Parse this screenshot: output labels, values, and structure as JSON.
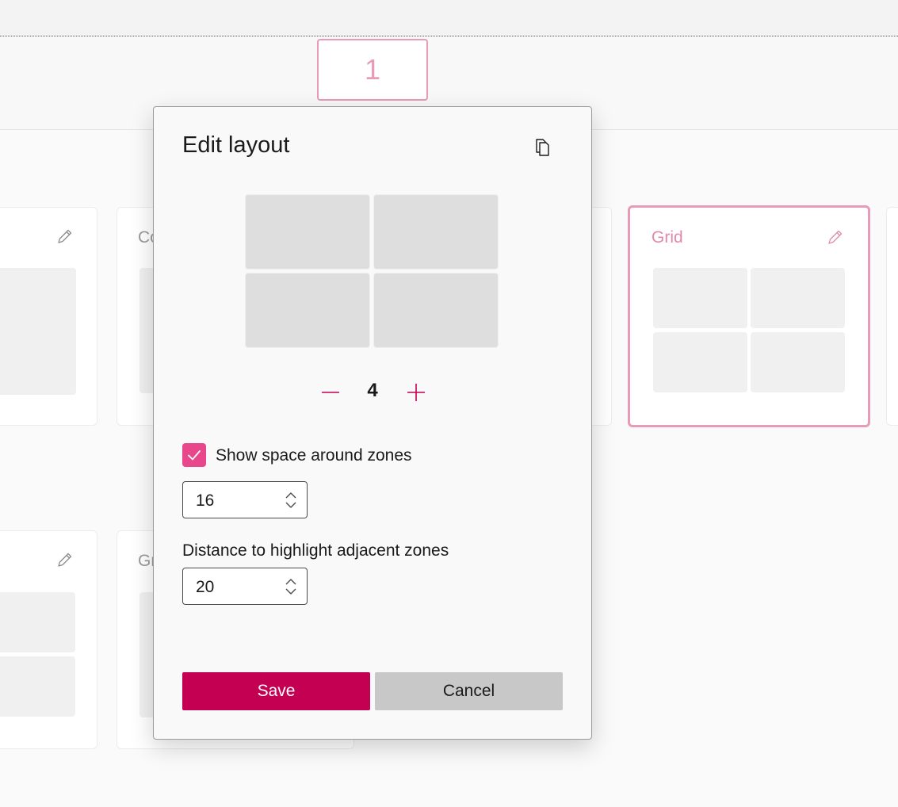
{
  "monitor": {
    "number": "1"
  },
  "cards": {
    "row1_left_title": "",
    "columns_title_partial": "Co",
    "grid_title": "Grid",
    "row2_middle_title_partial": "Gr"
  },
  "dialog": {
    "title": "Edit layout",
    "zone_count": "4",
    "show_space_label": "Show space around zones",
    "show_space_checked": true,
    "space_value": "16",
    "distance_label": "Distance to highlight adjacent zones",
    "distance_value": "20",
    "save_label": "Save",
    "cancel_label": "Cancel"
  },
  "colors": {
    "accent": "#c40052",
    "accent_light": "#e89ab8",
    "checkbox": "#e8478b",
    "zone_fill": "#dedede"
  },
  "icons": {
    "copy": "copy-icon",
    "edit": "pencil-icon",
    "minus": "minus-icon",
    "plus": "plus-icon",
    "spin": "chevron-up-down-icon",
    "check": "checkmark-icon"
  }
}
